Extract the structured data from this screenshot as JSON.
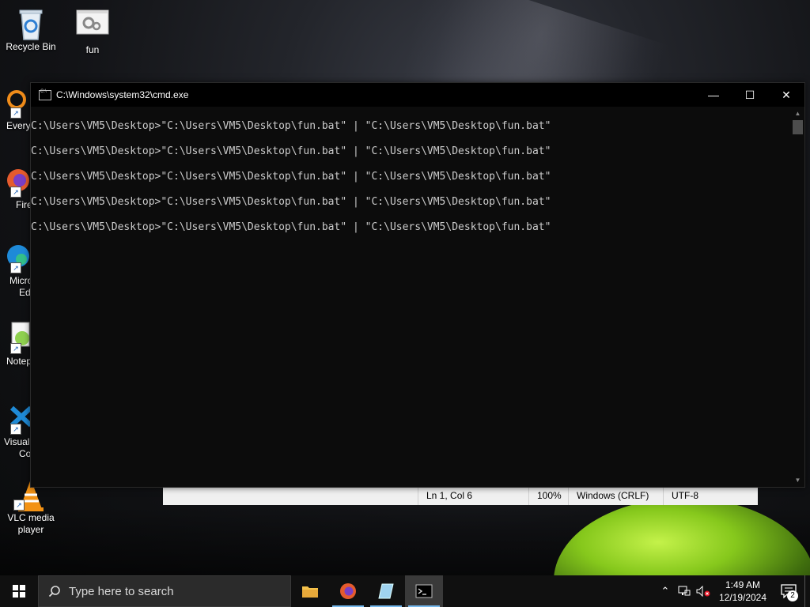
{
  "desktop": {
    "icons": [
      {
        "label": "Recycle Bin"
      },
      {
        "label": "fun"
      },
      {
        "label": "Every"
      },
      {
        "label": "Fire"
      },
      {
        "label": "Micro"
      },
      {
        "label": "Ed"
      },
      {
        "label": "Notep"
      },
      {
        "label": "Visual"
      },
      {
        "label": "Co"
      },
      {
        "label": "VLC media"
      },
      {
        "label": "player"
      }
    ]
  },
  "cmd_window": {
    "title": "C:\\Windows\\system32\\cmd.exe",
    "minimize_glyph": "—",
    "maximize_glyph": "☐",
    "close_glyph": "✕",
    "lines": [
      "C:\\Users\\VM5\\Desktop>\"C:\\Users\\VM5\\Desktop\\fun.bat\" | \"C:\\Users\\VM5\\Desktop\\fun.bat\"",
      "C:\\Users\\VM5\\Desktop>\"C:\\Users\\VM5\\Desktop\\fun.bat\" | \"C:\\Users\\VM5\\Desktop\\fun.bat\"",
      "C:\\Users\\VM5\\Desktop>\"C:\\Users\\VM5\\Desktop\\fun.bat\" | \"C:\\Users\\VM5\\Desktop\\fun.bat\"",
      "C:\\Users\\VM5\\Desktop>\"C:\\Users\\VM5\\Desktop\\fun.bat\" | \"C:\\Users\\VM5\\Desktop\\fun.bat\"",
      "C:\\Users\\VM5\\Desktop>\"C:\\Users\\VM5\\Desktop\\fun.bat\" | \"C:\\Users\\VM5\\Desktop\\fun.bat\""
    ]
  },
  "notepad_status": {
    "position": "Ln 1, Col 6",
    "zoom": "100%",
    "line_endings": "Windows (CRLF)",
    "encoding": "UTF-8"
  },
  "taskbar": {
    "search_placeholder": "Type here to search",
    "apps": [
      "file-explorer",
      "firefox",
      "notepad",
      "command-prompt"
    ],
    "time": "1:49 AM",
    "date": "12/19/2024",
    "notification_count": "2"
  },
  "colors": {
    "console_bg": "#0c0c0c",
    "console_text": "#cccccc",
    "taskbar_bg": "#101010",
    "accent": "#76b9ed"
  }
}
